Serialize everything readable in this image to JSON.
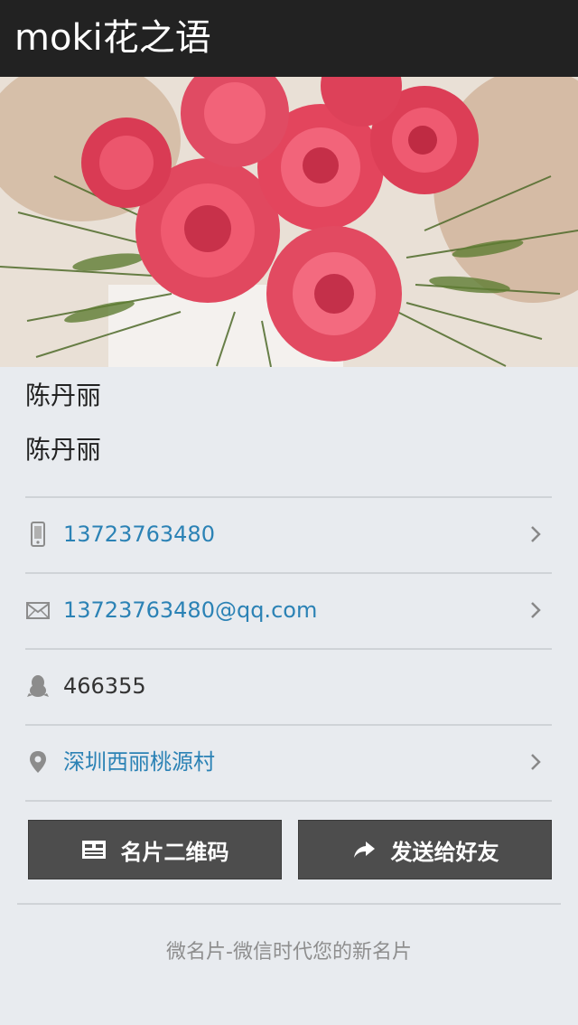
{
  "header": {
    "title": "moki花之语"
  },
  "profile": {
    "name_line_1": "陈丹丽",
    "name_line_2": "陈丹丽"
  },
  "contacts": {
    "phone": {
      "icon": "mobile-phone-icon",
      "value": "13723763480"
    },
    "email": {
      "icon": "envelope-icon",
      "value": "13723763480@qq.com"
    },
    "qq": {
      "icon": "qq-penguin-icon",
      "value": "466355"
    },
    "address": {
      "icon": "location-pin-icon",
      "value": "深圳西丽桃源村"
    }
  },
  "actions": {
    "qr_label": "名片二维码",
    "share_label": "发送给好友"
  },
  "footer": {
    "text": "微名片-微信时代您的新名片"
  },
  "colors": {
    "topbar": "#222222",
    "background": "#e8ebef",
    "link": "#2b82b5",
    "button": "#4d4d4d"
  }
}
